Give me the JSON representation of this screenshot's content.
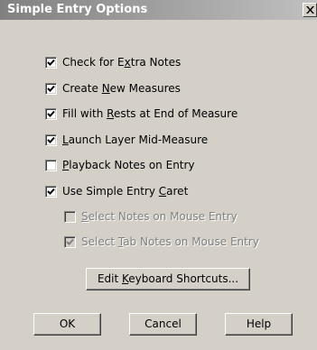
{
  "window": {
    "title": "Simple Entry Options",
    "close_glyph": "x",
    "title_gradient": [
      "#808080",
      "#c0c0c0"
    ],
    "face_color": "#d4d0c8"
  },
  "options": [
    {
      "pre": "Check for E",
      "key": "x",
      "post": "tra Notes",
      "checked": true,
      "enabled": true
    },
    {
      "pre": "Create ",
      "key": "N",
      "post": "ew Measures",
      "checked": true,
      "enabled": true
    },
    {
      "pre": "Fill with ",
      "key": "R",
      "post": "ests at End of Measure",
      "checked": true,
      "enabled": true
    },
    {
      "pre": "",
      "key": "L",
      "post": "aunch Layer Mid-Measure",
      "checked": true,
      "enabled": true
    },
    {
      "pre": "",
      "key": "P",
      "post": "layback Notes on Entry",
      "checked": false,
      "enabled": true
    },
    {
      "pre": "Use Simple Entry ",
      "key": "C",
      "post": "aret",
      "checked": true,
      "enabled": true
    },
    {
      "pre": "",
      "key": "S",
      "post": "elect Notes on Mouse Entry",
      "checked": false,
      "enabled": false
    },
    {
      "pre": "Select ",
      "key": "T",
      "post": "ab Notes on Mouse Entry",
      "checked": true,
      "enabled": false
    }
  ],
  "buttons": {
    "edit_shortcuts": {
      "pre": "Edit ",
      "key": "K",
      "post": "eyboard Shortcuts..."
    },
    "ok": {
      "label": "OK"
    },
    "cancel": {
      "label": "Cancel"
    },
    "help": {
      "label": "Help"
    }
  }
}
